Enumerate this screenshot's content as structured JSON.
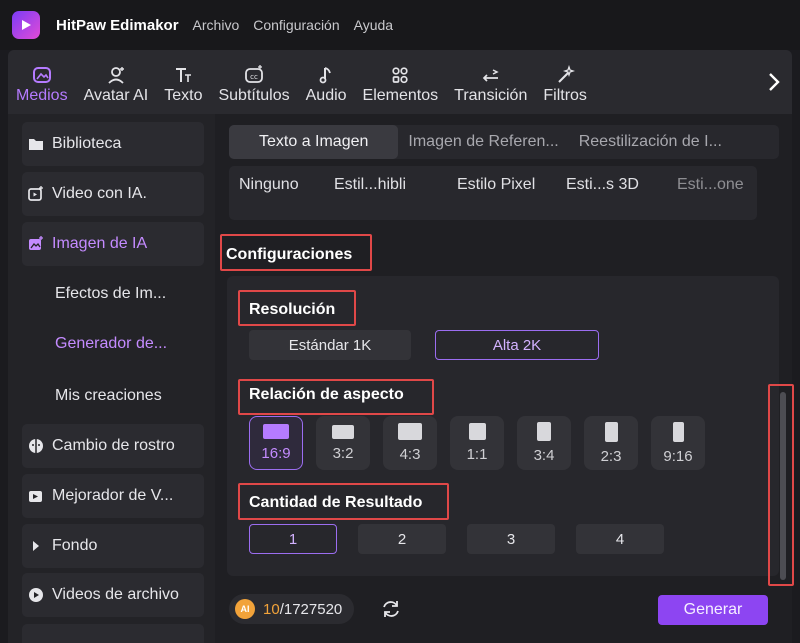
{
  "app": {
    "name": "HitPaw Edimakor",
    "menu": [
      "Archivo",
      "Configuración",
      "Ayuda"
    ]
  },
  "toolbar": {
    "items": [
      {
        "label": "Medios",
        "icon": "media-icon",
        "active": true
      },
      {
        "label": "Avatar AI",
        "icon": "avatar-icon"
      },
      {
        "label": "Texto",
        "icon": "text-icon"
      },
      {
        "label": "Subtítulos",
        "icon": "subtitles-icon"
      },
      {
        "label": "Audio",
        "icon": "audio-icon"
      },
      {
        "label": "Elementos",
        "icon": "elements-icon"
      },
      {
        "label": "Transición",
        "icon": "transition-icon"
      },
      {
        "label": "Filtros",
        "icon": "filters-icon"
      }
    ],
    "next_icon": "chevron-right-icon"
  },
  "sidebar": {
    "items": [
      {
        "label": "Biblioteca",
        "icon": "folder-icon"
      },
      {
        "label": "Video con IA.",
        "icon": "ai-video-icon"
      },
      {
        "label": "Imagen de IA",
        "icon": "ai-image-icon",
        "active": true
      },
      {
        "label": "Cambio de rostro",
        "icon": "face-swap-icon"
      },
      {
        "label": "Mejorador de V...",
        "icon": "enhancer-icon"
      },
      {
        "label": "Fondo",
        "icon": "caret-right-icon"
      },
      {
        "label": "Videos de archivo",
        "icon": "stock-video-icon"
      }
    ],
    "subitems": [
      {
        "label": "Efectos de Im..."
      },
      {
        "label": "Generador de...",
        "active": true
      },
      {
        "label": "Mis creaciones"
      }
    ]
  },
  "main": {
    "tabs": [
      {
        "label": "Texto a Imagen",
        "active": true
      },
      {
        "label": "Imagen de Referen..."
      },
      {
        "label": "Reestilización de I..."
      }
    ],
    "styles": [
      "Ninguno",
      "Estil...hibli",
      "Estilo Pixel",
      "Esti...s 3D",
      "Esti...one"
    ],
    "config_title": "Configuraciones",
    "resolution": {
      "title": "Resolución",
      "options": [
        {
          "label": "Estándar 1K"
        },
        {
          "label": "Alta 2K",
          "selected": true
        }
      ]
    },
    "aspect": {
      "title": "Relación de aspecto",
      "options": [
        {
          "label": "16:9",
          "selected": true
        },
        {
          "label": "3:2"
        },
        {
          "label": "4:3"
        },
        {
          "label": "1:1"
        },
        {
          "label": "3:4"
        },
        {
          "label": "2:3"
        },
        {
          "label": "9:16"
        }
      ]
    },
    "quantity": {
      "title": "Cantidad de Resultado",
      "options": [
        {
          "label": "1",
          "selected": true
        },
        {
          "label": "2"
        },
        {
          "label": "3"
        },
        {
          "label": "4"
        }
      ]
    },
    "footer": {
      "coin_label": "AI",
      "credits_used": "10",
      "credits_total": "/1727520",
      "generate_label": "Generar"
    }
  },
  "colors": {
    "accent": "#9b6df0",
    "accent_text": "#c48bff",
    "highlight": "#e04848",
    "generate": "#8d45f2",
    "coin": "#f2a33a"
  }
}
